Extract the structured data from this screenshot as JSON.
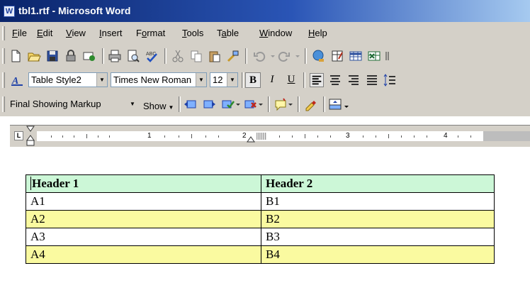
{
  "window": {
    "title": "tbl1.rtf - Microsoft Word",
    "app_icon": "W"
  },
  "menubar": [
    {
      "label": "File"
    },
    {
      "label": "Edit"
    },
    {
      "label": "View"
    },
    {
      "label": "Insert"
    },
    {
      "label": "Format"
    },
    {
      "label": "Tools"
    },
    {
      "label": "Table"
    },
    {
      "label": "Window"
    },
    {
      "label": "Help"
    }
  ],
  "formatting": {
    "style": "Table Style2",
    "font": "Times New Roman",
    "size": "12",
    "bold": "B",
    "italic": "I",
    "underline": "U"
  },
  "reviewing": {
    "display_mode": "Final Showing Markup",
    "show_label": "Show"
  },
  "ruler": {
    "numbers": [
      "1",
      "2",
      "3",
      "4"
    ]
  },
  "table": {
    "headers": [
      "Header 1",
      "Header 2"
    ],
    "rows": [
      [
        "A1",
        "B1"
      ],
      [
        "A2",
        "B2"
      ],
      [
        "A3",
        "B3"
      ],
      [
        "A4",
        "B4"
      ]
    ]
  },
  "colors": {
    "header_row": "#ccf7d7",
    "band_row": "#fafaa0",
    "title_bar": "#0a246a"
  }
}
